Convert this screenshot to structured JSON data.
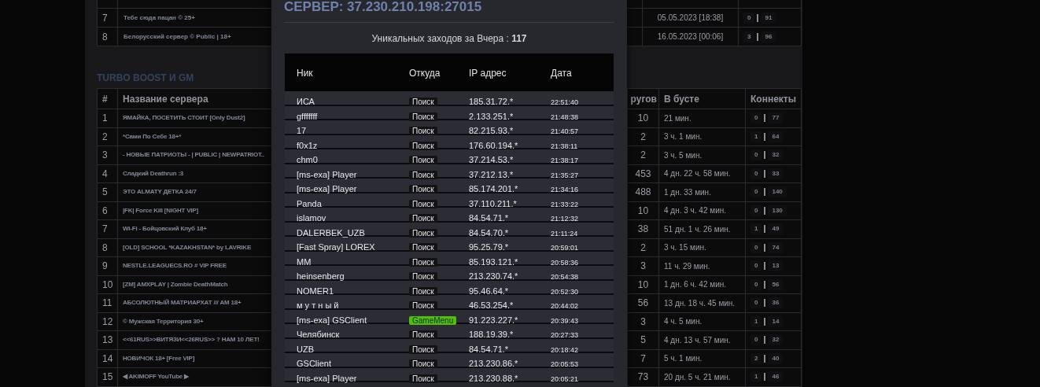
{
  "background_page": {
    "top_table": {
      "rows": [
        {
          "number": "7",
          "name": "Тебе сюда пацан © 25+",
          "date": "05.05.2023 [18:38]",
          "connects_a": "0",
          "connects_b": "91"
        },
        {
          "number": "8",
          "name": "Белорусский сервер © Public | 18+",
          "date": "16.05.2023 [00:06]",
          "connects_a": "3",
          "connects_b": "96"
        }
      ]
    },
    "section_title": "TURBO BOOST И GM",
    "servers_table": {
      "columns": [
        "#",
        "Название сервера",
        "ругов",
        "В бусте",
        "Коннекты"
      ],
      "rows": [
        {
          "number": "1",
          "name": "ЯМАЙКА, ПОСЕТИТЬ СТОИТ [Only Dust2]",
          "rounds": "10",
          "boost": "21 мин.",
          "connects_a": "0",
          "connects_b": "77"
        },
        {
          "number": "2",
          "name": "*Сами По Себе 18+*",
          "rounds": "2",
          "boost": "3 ч. 1 мин.",
          "connects_a": "1",
          "connects_b": "64"
        },
        {
          "number": "3",
          "name": "- НОВЫЕ ПАТРИОТЫ - | PUBLIC | NEWPATRIOT..",
          "rounds": "2",
          "boost": "3 ч. 5 мин.",
          "connects_a": "0",
          "connects_b": "32"
        },
        {
          "number": "4",
          "name": "Сладкий Deathrun :3",
          "rounds": "453",
          "boost": "4 дн. 22 ч. 58 мин.",
          "connects_a": "0",
          "connects_b": "33"
        },
        {
          "number": "5",
          "name": "ЭТО ALMATY ДЕТКА 24/7",
          "rounds": "488",
          "boost": "1 дн. 33 мин.",
          "connects_a": "0",
          "connects_b": "140"
        },
        {
          "number": "6",
          "name": "|FK| Force Kill [NIGHT VIP]",
          "rounds": "10",
          "boost": "4 дн. 3 ч. 42 мин.",
          "connects_a": "0",
          "connects_b": "130"
        },
        {
          "number": "7",
          "name": "Wi-Fi - Бойцовский Клуб 18+",
          "rounds": "38",
          "boost": "51 дн. 1 ч. 26 мин.",
          "connects_a": "1",
          "connects_b": "49"
        },
        {
          "number": "8",
          "name": "[OLD] SCHOOL *KAZAKHSTAN* by LAVRIKE",
          "rounds": "2",
          "boost": "3 ч. 15 мин.",
          "connects_a": "0",
          "connects_b": "74"
        },
        {
          "number": "9",
          "name": "NESTLE.LEAGUECS.RO # VIP FREE",
          "rounds": "3",
          "boost": "11 ч. 29 мин.",
          "connects_a": "0",
          "connects_b": "13"
        },
        {
          "number": "10",
          "name": "[ZM] AMXPLAY | Zombie DeathMatch",
          "rounds": "10",
          "boost": "1 дн. 6 ч. 42 мин.",
          "connects_a": "0",
          "connects_b": "56"
        },
        {
          "number": "11",
          "name": "АБСОЛЮТНЫЙ МАТРИАРХАТ /// AM 18+",
          "rounds": "56",
          "boost": "13 дн. 18 ч. 45 мин.",
          "connects_a": "0",
          "connects_b": "36"
        },
        {
          "number": "12",
          "name": "© Мужская Территория 30+",
          "rounds": "3",
          "boost": "4 ч. 5 мин.",
          "connects_a": "1",
          "connects_b": "14"
        },
        {
          "number": "13",
          "name": "<<61RUS>>ВИТЯЗИ<<26RUS>> ? НАМ 10 ЛЕТ!",
          "rounds": "5",
          "boost": "4 дн. 13 ч. 57 мин.",
          "connects_a": "0",
          "connects_b": "32"
        },
        {
          "number": "14",
          "name": "НОВИЧОК 18+ [Free VIP]",
          "rounds": "7",
          "boost": "5 ч. 1 мин.",
          "connects_a": "2",
          "connects_b": "40"
        },
        {
          "number": "15",
          "name": "◀ AKIMOFF YouTube ▶",
          "rounds": "73",
          "boost": "20 дн. 5 ч. 21 мин.",
          "connects_a": "1",
          "connects_b": "46"
        }
      ]
    }
  },
  "modal": {
    "title": "СЕРВЕР: 37.230.210.198:27015",
    "summary": "Уникальных заходов за Вчера : **117**",
    "table": {
      "columns": [
        "Ник",
        "Откуда",
        "IP адрес",
        "Дата"
      ],
      "rows": [
        {
          "nick": "ИСА",
          "source": {
            "label": "Поиск",
            "kind": "search"
          },
          "ip": "185.31.72.*",
          "time": "22:51:40"
        },
        {
          "nick": "gfffffff",
          "source": {
            "label": "Поиск",
            "kind": "search"
          },
          "ip": "2.133.251.*",
          "time": "21:48:38"
        },
        {
          "nick": "17",
          "source": {
            "label": "Поиск",
            "kind": "search"
          },
          "ip": "82.215.93.*",
          "time": "21:40:57"
        },
        {
          "nick": "f0x1z",
          "source": {
            "label": "Поиск",
            "kind": "search"
          },
          "ip": "176.60.194.*",
          "time": "21:38:11"
        },
        {
          "nick": "chm0",
          "source": {
            "label": "Поиск",
            "kind": "search"
          },
          "ip": "37.214.53.*",
          "time": "21:38:17"
        },
        {
          "nick": "[ms-exa] Player",
          "source": {
            "label": "Поиск",
            "kind": "search"
          },
          "ip": "37.212.13.*",
          "time": "21:35:27"
        },
        {
          "nick": "[ms-exa] Player",
          "source": {
            "label": "Поиск",
            "kind": "search"
          },
          "ip": "85.174.201.*",
          "time": "21:34:16"
        },
        {
          "nick": "Panda",
          "source": {
            "label": "Поиск",
            "kind": "search"
          },
          "ip": "37.110.211.*",
          "time": "21:33:22"
        },
        {
          "nick": "islamov",
          "source": {
            "label": "Поиск",
            "kind": "search"
          },
          "ip": "84.54.71.*",
          "time": "21:12:32"
        },
        {
          "nick": "DALERBEK_UZB",
          "source": {
            "label": "Поиск",
            "kind": "search"
          },
          "ip": "84.54.70.*",
          "time": "21:11:24"
        },
        {
          "nick": "[Fast Spray] LOREX",
          "source": {
            "label": "Поиск",
            "kind": "search"
          },
          "ip": "95.25.79.*",
          "time": "20:59:01"
        },
        {
          "nick": "MM",
          "source": {
            "label": "Поиск",
            "kind": "search"
          },
          "ip": "85.193.121.*",
          "time": "20:58:36"
        },
        {
          "nick": "heinsenberg",
          "source": {
            "label": "Поиск",
            "kind": "search"
          },
          "ip": "213.230.74.*",
          "time": "20:54:38"
        },
        {
          "nick": "NOMER1",
          "source": {
            "label": "Поиск",
            "kind": "search"
          },
          "ip": "95.46.64.*",
          "time": "20:52:30"
        },
        {
          "nick": "м у т н ы й",
          "source": {
            "label": "Поиск",
            "kind": "search"
          },
          "ip": "46.53.254.*",
          "time": "20:44:02"
        },
        {
          "nick": "[ms-exa] GSClient",
          "source": {
            "label": "GameMenu",
            "kind": "game_menu"
          },
          "ip": "91.223.227.*",
          "time": "20:39:43"
        },
        {
          "nick": "Челябинск",
          "source": {
            "label": "Поиск",
            "kind": "search"
          },
          "ip": "188.19.39.*",
          "time": "20:27:33"
        },
        {
          "nick": "UZB",
          "source": {
            "label": "Поиск",
            "kind": "search"
          },
          "ip": "84.54.71.*",
          "time": "20:18:42"
        },
        {
          "nick": "GSClient",
          "source": {
            "label": "Поиск",
            "kind": "search"
          },
          "ip": "213.230.86.*",
          "time": "20:05:53"
        },
        {
          "nick": "[ms-exa] Player",
          "source": {
            "label": "Поиск",
            "kind": "search"
          },
          "ip": "213.230.88.*",
          "time": "20:05:21"
        }
      ]
    }
  }
}
